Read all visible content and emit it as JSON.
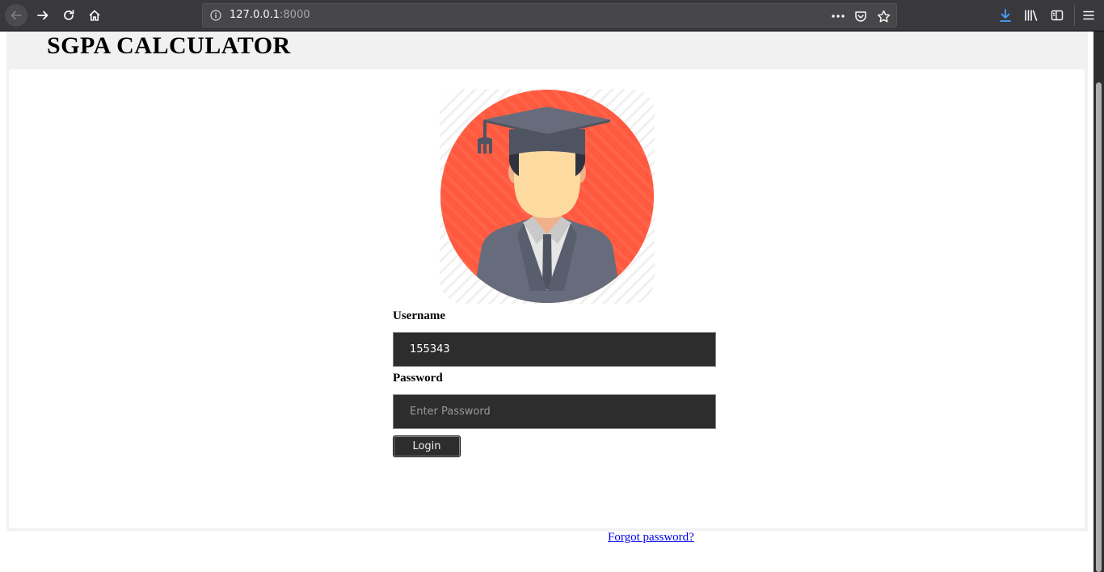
{
  "browser": {
    "url_host": "127.0.0.1",
    "url_port": ":8000",
    "icons": [
      "back-arrow-icon",
      "forward-arrow-icon",
      "reload-icon",
      "home-icon",
      "info-icon",
      "more-dots-icon",
      "pocket-icon",
      "bookmark-star-icon",
      "download-icon",
      "library-icon",
      "sidebar-icon",
      "menu-icon"
    ],
    "accent_color": "#45a1ff"
  },
  "page": {
    "title": "SGPA CALCULATOR",
    "avatar": "graduate-avatar"
  },
  "login": {
    "username_label": "Username",
    "username_value": "155343",
    "password_label": "Password",
    "password_placeholder": "Enter Password",
    "login_label": "Login",
    "forgot_label": "Forgot password?"
  },
  "colors": {
    "avatar_circle": "#ff5a3f",
    "field_bg": "#2d2d2d",
    "link": "#0000ee"
  }
}
